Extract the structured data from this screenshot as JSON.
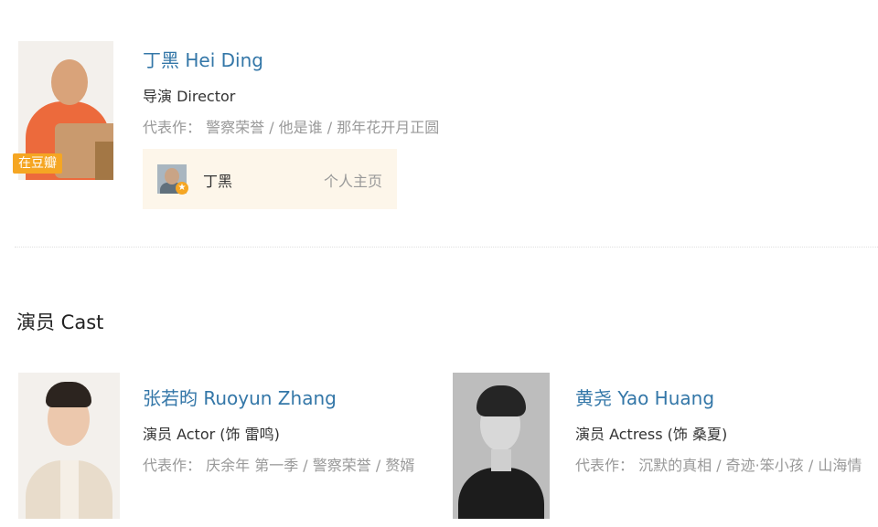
{
  "director": {
    "name": "丁黑 Hei Ding",
    "role": "导演 Director",
    "works_label": "代表作：",
    "works": "警察荣誉 / 他是谁 / 那年花开月正圆",
    "badge": "在豆瓣",
    "profile": {
      "name": "丁黑",
      "link_label": "个人主页"
    }
  },
  "cast_section": {
    "title": "演员 Cast"
  },
  "cast": [
    {
      "name": "张若昀 Ruoyun Zhang",
      "role": "演员 Actor (饰 雷鸣)",
      "works_label": "代表作：",
      "works": "庆余年 第一季 / 警察荣誉 / 赘婿"
    },
    {
      "name": "黄尧 Yao Huang",
      "role": "演员 Actress (饰 桑夏)",
      "works_label": "代表作：",
      "works": "沉默的真相 / 奇迹·笨小孩 / 山海情"
    }
  ],
  "colors": {
    "link_blue": "#3477a8",
    "muted_gray": "#999999",
    "badge_orange": "#f5a623",
    "card_bg": "#fdf6ea"
  }
}
